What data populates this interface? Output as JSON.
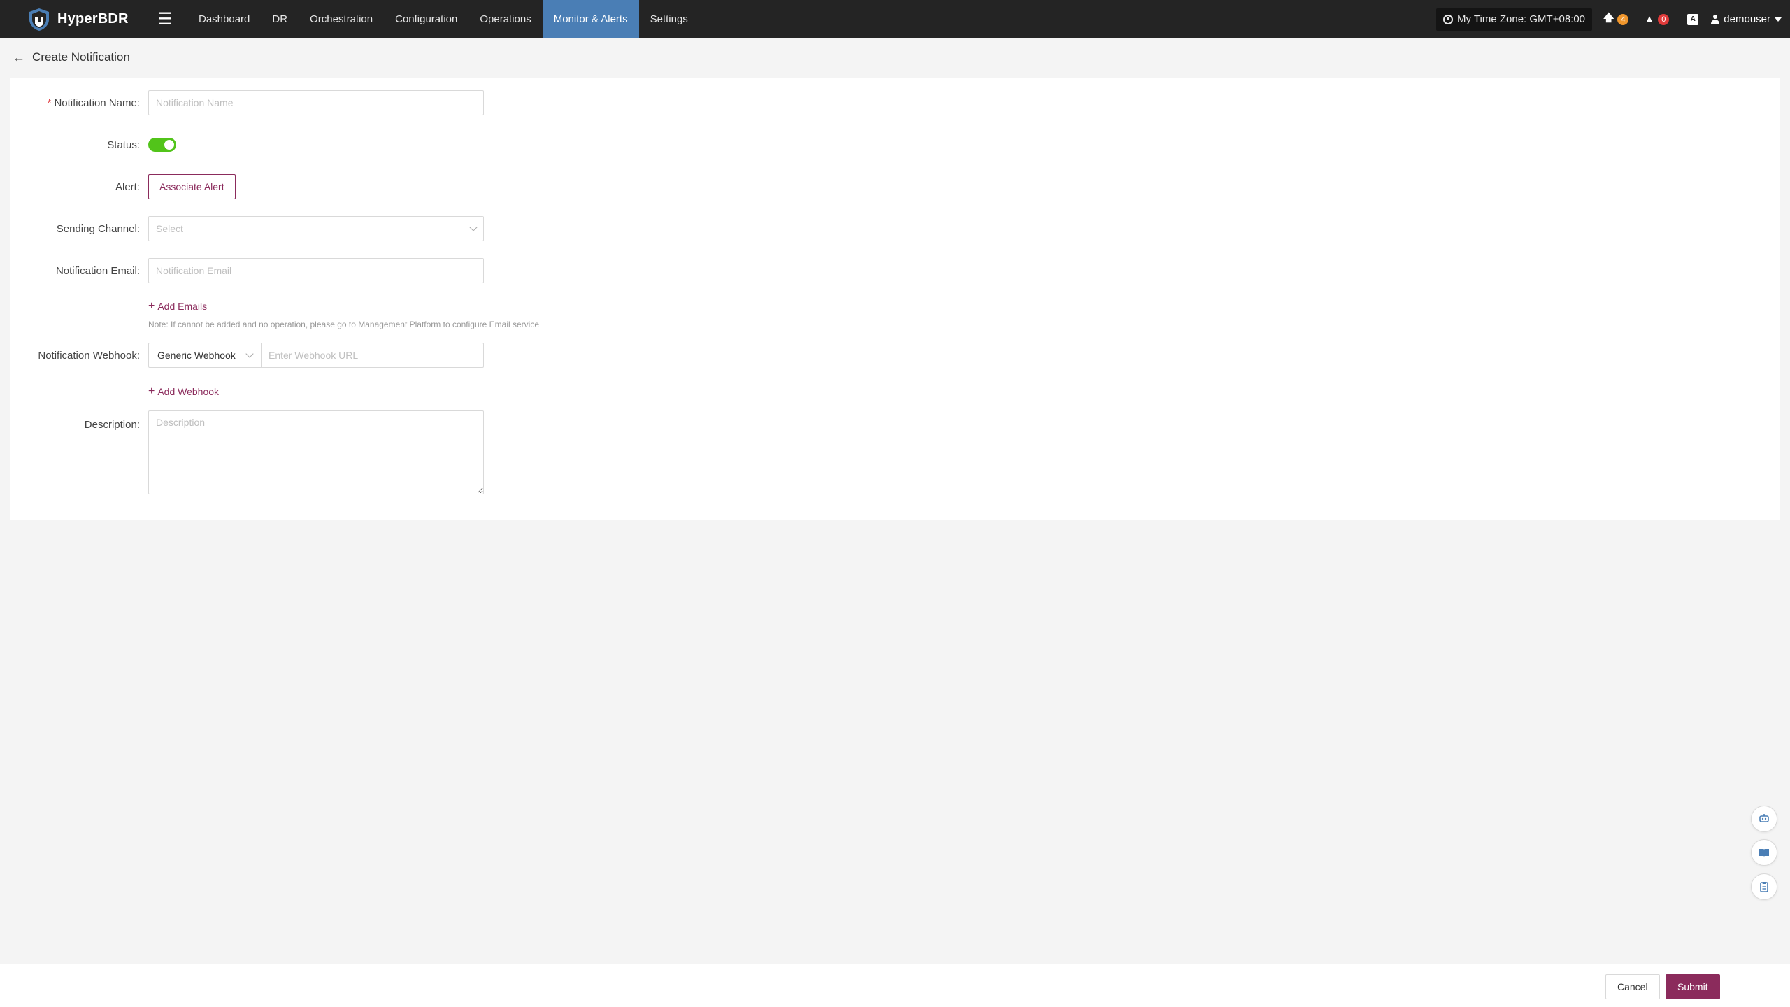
{
  "app": {
    "name": "HyperBDR",
    "logo_icon": "shield-logo-icon",
    "menu_icon": "hamburger-icon"
  },
  "nav": {
    "items": [
      {
        "label": "Dashboard",
        "active": false
      },
      {
        "label": "DR",
        "active": false
      },
      {
        "label": "Orchestration",
        "active": false
      },
      {
        "label": "Configuration",
        "active": false
      },
      {
        "label": "Operations",
        "active": false
      },
      {
        "label": "Monitor & Alerts",
        "active": true
      },
      {
        "label": "Settings",
        "active": false
      }
    ]
  },
  "topbar": {
    "timezone_label": "My Time Zone: GMT+08:00",
    "upload_count": "4",
    "alert_count": "0",
    "lang_icon_text": "A",
    "username": "demouser"
  },
  "page": {
    "title": "Create Notification"
  },
  "form": {
    "name_label": "Notification Name:",
    "name_required_mark": "*",
    "name_placeholder": "Notification Name",
    "status_label": "Status:",
    "status_on": true,
    "alert_label": "Alert:",
    "associate_alert_button": "Associate Alert",
    "channel_label": "Sending Channel:",
    "channel_placeholder": "Select",
    "email_label": "Notification Email:",
    "email_placeholder": "Notification Email",
    "add_emails_link": "Add Emails",
    "email_note": "Note: If cannot be added and no operation, please go to Management Platform to configure Email service",
    "webhook_label": "Notification Webhook:",
    "webhook_type": "Generic Webhook",
    "webhook_placeholder": "Enter Webhook URL",
    "add_webhook_link": "Add Webhook",
    "description_label": "Description:",
    "description_placeholder": "Description"
  },
  "footer": {
    "cancel_label": "Cancel",
    "submit_label": "Submit"
  },
  "colors": {
    "topbar_bg": "#242424",
    "nav_active_bg": "#4a7eb5",
    "accent": "#8b2b5c",
    "toggle_on": "#52c41a",
    "badge_orange": "#f0962c",
    "badge_red": "#e03a3a",
    "required": "#e0393e"
  }
}
